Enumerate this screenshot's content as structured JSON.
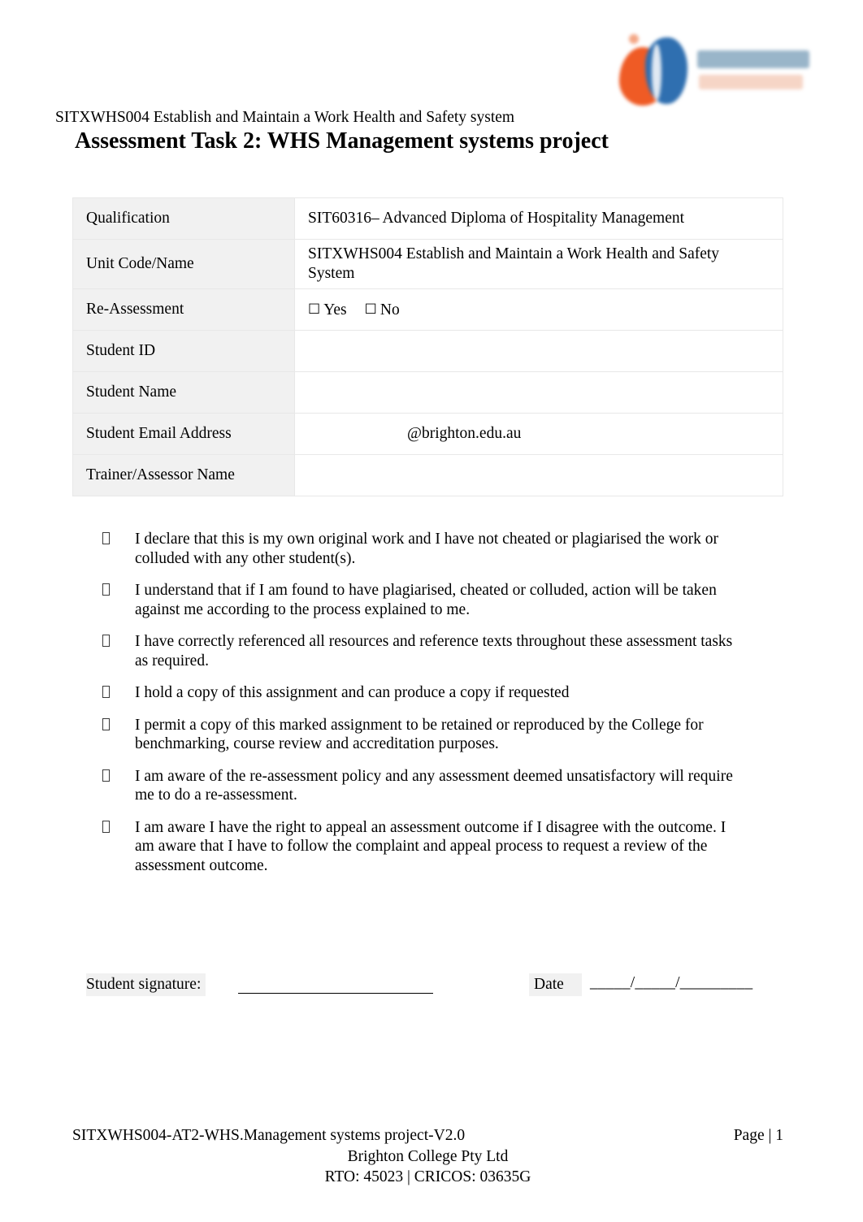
{
  "header": {
    "unit_line": "SITXWHS004 Establish and Maintain a Work Health and Safety system",
    "title": "Assessment Task 2: WHS Management systems project",
    "logo_alt": "Brighton College logo"
  },
  "info_table": {
    "rows": [
      {
        "label": "Qualification",
        "value": "SIT60316– Advanced Diploma of Hospitality Management",
        "type": "text"
      },
      {
        "label": "Unit Code/Name",
        "value": "SITXWHS004 Establish and Maintain a Work Health and Safety System",
        "type": "text"
      },
      {
        "label": "Re-Assessment",
        "value": "",
        "type": "checkbox"
      },
      {
        "label": "Student ID",
        "value": "",
        "type": "text"
      },
      {
        "label": "Student Name",
        "value": "",
        "type": "text"
      },
      {
        "label": "Student Email Address",
        "value": "@brighton.edu.au",
        "type": "email"
      },
      {
        "label": "Trainer/Assessor Name",
        "value": "",
        "type": "text"
      }
    ],
    "reassessment": {
      "checkbox_glyph": "☐",
      "yes_label": "Yes",
      "no_label": "No",
      "yes_checked": false,
      "no_checked": false
    }
  },
  "declarations": [
    "I declare that this is my own original work and I have not cheated or plagiarised the work or colluded with any other student(s).",
    "I understand that if I am found to have plagiarised, cheated or colluded, action will be taken against me according to the process explained to me.",
    "I have correctly referenced all resources and reference texts throughout these assessment tasks as required.",
    "I hold a copy of this assignment and can produce a copy if requested",
    "I permit a copy of this marked assignment to be retained or reproduced by the College for benchmarking, course review and accreditation purposes.",
    "I am aware of the re-assessment policy and any assessment deemed unsatisfactory will require me to do a re-assessment.",
    "I am aware I have the right to appeal an assessment outcome if I disagree with the outcome. I am aware that I have to follow the complaint and appeal process to request a review of the assessment outcome."
  ],
  "signature": {
    "student_label": "Student signature:",
    "student_value": "",
    "date_label": "Date",
    "date_value": "_____/_____/_________"
  },
  "footer": {
    "document_ref": "SITXWHS004-AT2-WHS.Management systems project-V2.0",
    "page_number": "Page | 1",
    "company": "Brighton College Pty Ltd",
    "registration": "RTO: 45023 | CRICOS: 03635G"
  },
  "colors": {
    "logo_orange": "#ef5b25",
    "logo_blue": "#2f6fb0",
    "label_cell_bg": "#f1f1f1",
    "table_border": "#e8e8e8"
  }
}
